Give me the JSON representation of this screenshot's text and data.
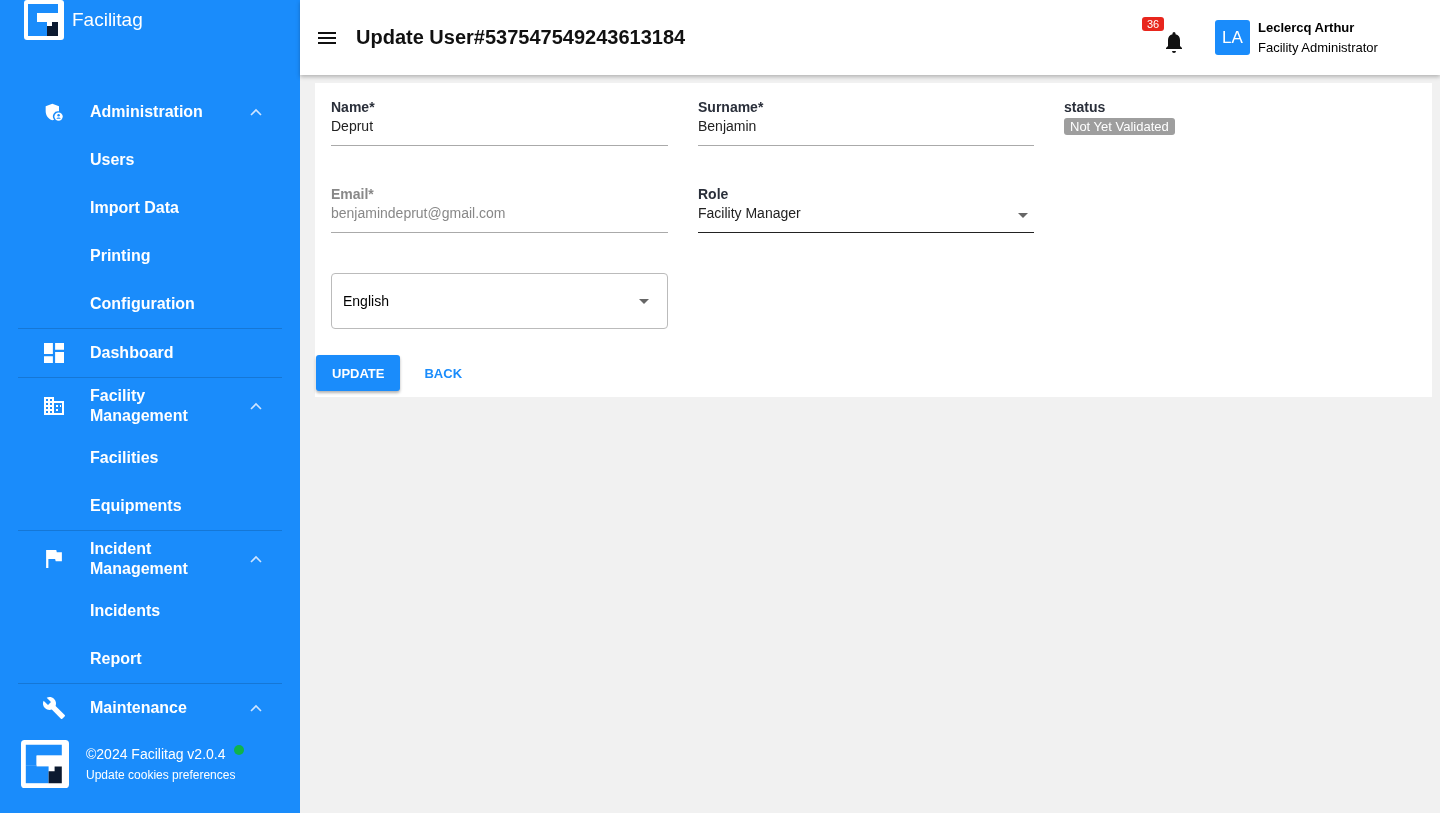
{
  "brand": {
    "name": "Facilitag"
  },
  "sidebar": {
    "groups": [
      {
        "kind": "group",
        "label": "Administration",
        "expanded": true,
        "children": [
          {
            "label": "Users"
          },
          {
            "label": "Import Data"
          },
          {
            "label": "Printing"
          },
          {
            "label": "Configuration"
          }
        ]
      },
      {
        "kind": "link",
        "label": "Dashboard"
      },
      {
        "kind": "group",
        "label": "Facility Management",
        "expanded": true,
        "children": [
          {
            "label": "Facilities"
          },
          {
            "label": "Equipments"
          }
        ]
      },
      {
        "kind": "group",
        "label": "Incident Management",
        "expanded": true,
        "children": [
          {
            "label": "Incidents"
          },
          {
            "label": "Report"
          }
        ]
      },
      {
        "kind": "group",
        "label": "Maintenance",
        "expanded": true
      }
    ]
  },
  "footer": {
    "copyright": "©2024 Facilitag  v2.0.4",
    "online": true,
    "link": "Update cookies preferences"
  },
  "header": {
    "title": "Update User#537547549243613184",
    "notification_count": "36",
    "user": {
      "initials": "LA",
      "name": "Leclercq Arthur",
      "role": "Facility Administrator"
    }
  },
  "form": {
    "fields": [
      {
        "kind": "text",
        "label": "Name*",
        "value": "Deprut",
        "disabled": false
      },
      {
        "kind": "text",
        "label": "Surname*",
        "value": "Benjamin",
        "disabled": false
      },
      {
        "kind": "badge",
        "label": "status",
        "value": "Not Yet Validated"
      },
      {
        "kind": "text",
        "label": "Email*",
        "value": "benjamindeprut@gmail.com",
        "disabled": true
      },
      {
        "kind": "select",
        "label": "Role",
        "value": "Facility Manager",
        "disabled": false
      },
      {
        "kind": "empty"
      },
      {
        "kind": "outlined-select",
        "value": "English"
      }
    ],
    "buttons": [
      {
        "kind": "primary",
        "label": "UPDATE"
      },
      {
        "kind": "text",
        "label": "BACK"
      }
    ]
  }
}
